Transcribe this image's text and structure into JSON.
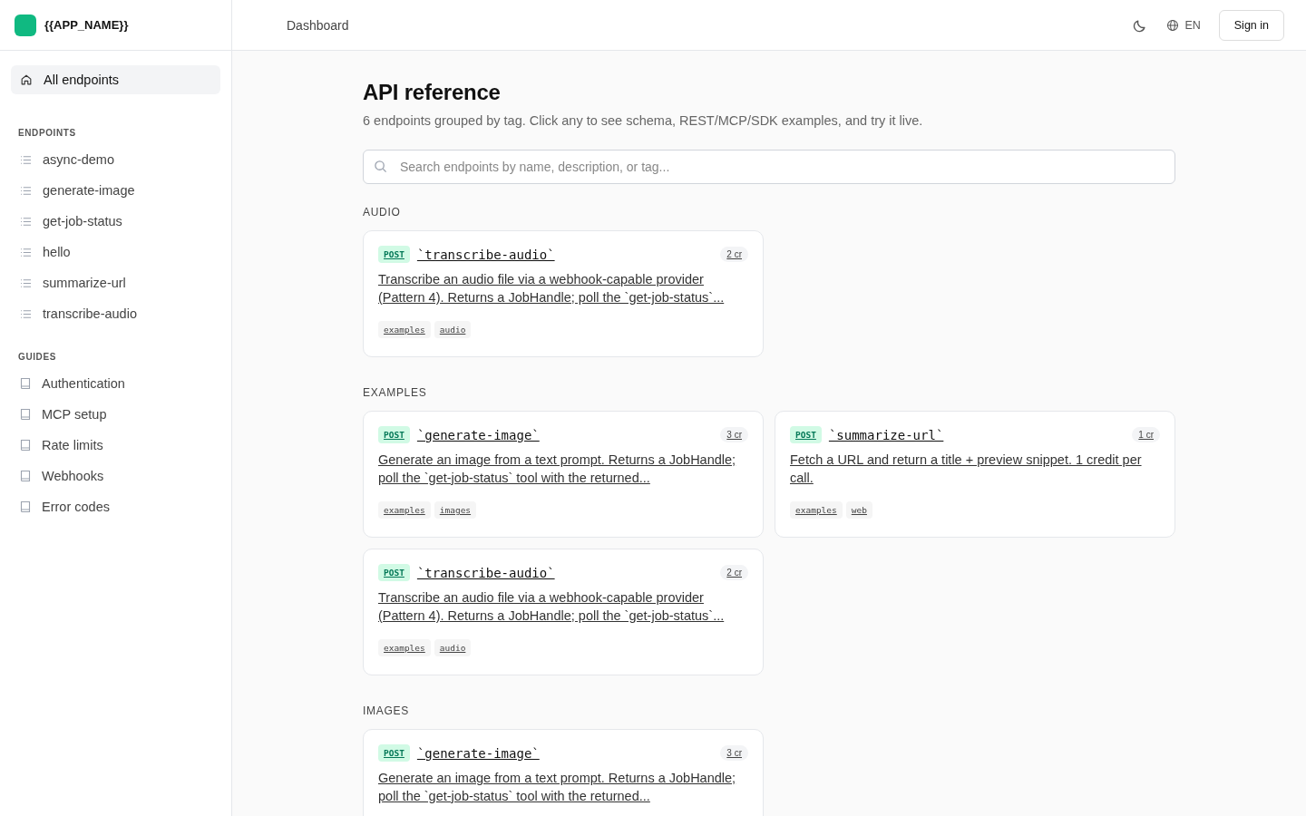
{
  "app_name": "{{APP_NAME}}",
  "breadcrumb": "Dashboard",
  "header": {
    "language": "EN",
    "sign_in": "Sign in"
  },
  "sidebar": {
    "top_item": {
      "label": "All endpoints",
      "selected": true
    },
    "sections": [
      {
        "heading": "ENDPOINTS",
        "kind": "endpoint",
        "items": [
          {
            "label": "async-demo",
            "selected": false
          },
          {
            "label": "generate-image",
            "selected": false
          },
          {
            "label": "get-job-status",
            "selected": false
          },
          {
            "label": "hello",
            "selected": false
          },
          {
            "label": "summarize-url",
            "selected": false
          },
          {
            "label": "transcribe-audio",
            "selected": false
          }
        ]
      },
      {
        "heading": "GUIDES",
        "kind": "guide",
        "items": [
          {
            "label": "Authentication",
            "selected": false
          },
          {
            "label": "MCP setup",
            "selected": false
          },
          {
            "label": "Rate limits",
            "selected": false
          },
          {
            "label": "Webhooks",
            "selected": false
          },
          {
            "label": "Error codes",
            "selected": false
          }
        ]
      }
    ]
  },
  "title": "API reference",
  "subtitle": "6 endpoints grouped by tag. Click any to see schema, REST/MCP/SDK examples, and try it live.",
  "search": {
    "placeholder": "Search endpoints by name, description, or tag..."
  },
  "groups": [
    {
      "heading": "AUDIO",
      "cards": [
        {
          "method": "POST",
          "name": "`transcribe-audio`",
          "cost": "2 cr",
          "description": "Transcribe an audio file via a webhook-capable provider (Pattern 4). Returns a JobHandle; poll the `get-job-status`...",
          "tags": [
            "examples",
            "audio"
          ]
        }
      ]
    },
    {
      "heading": "EXAMPLES",
      "cards": [
        {
          "method": "POST",
          "name": "`generate-image`",
          "cost": "3 cr",
          "description": "Generate an image from a text prompt. Returns a JobHandle; poll the `get-job-status` tool with the returned...",
          "tags": [
            "examples",
            "images"
          ]
        },
        {
          "method": "POST",
          "name": "`summarize-url`",
          "cost": "1 cr",
          "description": "Fetch a URL and return a title + preview snippet. 1 credit per call.",
          "tags": [
            "examples",
            "web"
          ]
        },
        {
          "method": "POST",
          "name": "`transcribe-audio`",
          "cost": "2 cr",
          "description": "Transcribe an audio file via a webhook-capable provider (Pattern 4). Returns a JobHandle; poll the `get-job-status`...",
          "tags": [
            "examples",
            "audio"
          ]
        }
      ]
    },
    {
      "heading": "IMAGES",
      "cards": [
        {
          "method": "POST",
          "name": "`generate-image`",
          "cost": "3 cr",
          "description": "Generate an image from a text prompt. Returns a JobHandle; poll the `get-job-status` tool with the returned..."
        }
      ]
    }
  ]
}
